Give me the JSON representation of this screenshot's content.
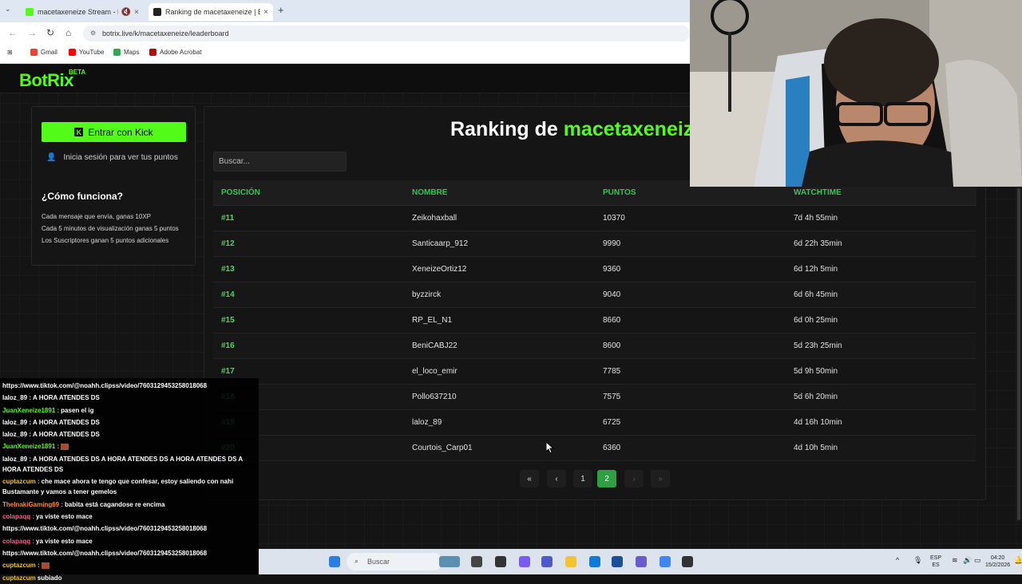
{
  "browser": {
    "tabs": [
      {
        "title": "macetaxeneize Stream - Ki"
      },
      {
        "title": "Ranking de macetaxeneize | B"
      }
    ],
    "url": "botrix.live/k/macetaxeneize/leaderboard",
    "bookmarks": [
      {
        "label": "Gmail",
        "color": "#ea4335"
      },
      {
        "label": "YouTube",
        "color": "#ff0000"
      },
      {
        "label": "Maps",
        "color": "#34a853"
      },
      {
        "label": "Adobe Acrobat",
        "color": "#b30b00"
      }
    ]
  },
  "site": {
    "logo": "BotRix",
    "beta": "BETA",
    "sidebar": {
      "kick_button": "Entrar con Kick",
      "kick_icon": "K",
      "login_text": "Inicia sesión para ver tus puntos",
      "how_title": "¿Cómo funciona?",
      "how_items": [
        "Cada mensaje que envía, ganas 10XP",
        "Cada 5 minutos de visualización ganas 5 puntos",
        "Los Suscriptores ganan 5 puntos adicionales"
      ]
    },
    "ranking": {
      "title_prefix": "Ranking de",
      "title_channel": "macetaxeneize",
      "search_placeholder": "Buscar...",
      "columns": [
        "POSICIÓN",
        "NOMBRE",
        "PUNTOS",
        "WATCHTIME"
      ],
      "rows": [
        {
          "pos": "#11",
          "name": "Zeikohaxball",
          "points": "10370",
          "watch": "7d 4h 55min"
        },
        {
          "pos": "#12",
          "name": "Santicaarp_912",
          "points": "9990",
          "watch": "6d 22h 35min"
        },
        {
          "pos": "#13",
          "name": "XeneizeOrtiz12",
          "points": "9360",
          "watch": "6d 12h 5min"
        },
        {
          "pos": "#14",
          "name": "byzzirck",
          "points": "9040",
          "watch": "6d 6h 45min"
        },
        {
          "pos": "#15",
          "name": "RP_EL_N1",
          "points": "8660",
          "watch": "6d 0h 25min"
        },
        {
          "pos": "#16",
          "name": "BeniCABJ22",
          "points": "8600",
          "watch": "5d 23h 25min"
        },
        {
          "pos": "#17",
          "name": "el_loco_emir",
          "points": "7785",
          "watch": "5d 9h 50min"
        },
        {
          "pos": "#18",
          "name": "Pollo637210",
          "points": "7575",
          "watch": "5d 6h 20min"
        },
        {
          "pos": "#19",
          "name": "laloz_89",
          "points": "6725",
          "watch": "4d 16h 10min"
        },
        {
          "pos": "#20",
          "name": "Courtois_Carp01",
          "points": "6360",
          "watch": "4d 10h 5min"
        }
      ],
      "pagination": {
        "first": "«",
        "prev": "‹",
        "pages": [
          "1",
          "2"
        ],
        "current": "2",
        "next": "›",
        "last": "»"
      }
    }
  },
  "chat": {
    "messages": [
      {
        "user": "",
        "text": "https://www.tiktok.com/@noahh.clipss/video/7603129453258018068",
        "color": "#ffffff"
      },
      {
        "user": "laloz_89 :",
        "text": "A HORA ATENDES DS",
        "color": "#ffffff"
      },
      {
        "user": "JuanXeneize1891 :",
        "text": "pasen el ig",
        "color": "#53fc18"
      },
      {
        "user": "laloz_89 :",
        "text": "A HORA ATENDES DS",
        "color": "#ffffff"
      },
      {
        "user": "laloz_89 :",
        "text": "A HORA ATENDES DS",
        "color": "#ffffff"
      },
      {
        "user": "JuanXeneize1891 :",
        "text": "",
        "color": "#53fc18"
      },
      {
        "user": "laloz_89 :",
        "text": "A HORA ATENDES DS A HORA ATENDES DS A HORA ATENDES DS A HORA ATENDES DS",
        "color": "#ffffff"
      },
      {
        "user": "cuptazcum :",
        "text": "che mace ahora te tengo que confesar, estoy saliendo con nahi Bustamante y vamos a tener gemelos",
        "color": "#f5c518"
      },
      {
        "user": "TheInakiGaming69 :",
        "text": "babita está cagandose re encima",
        "color": "#ff8c2a"
      },
      {
        "user": "colapaqq :",
        "text": "ya viste esto mace",
        "color": "#ff5d8f"
      },
      {
        "user": "",
        "text": "https://www.tiktok.com/@noahh.clipss/video/7603129453258018068",
        "color": "#ffffff"
      },
      {
        "user": "colapaqq :",
        "text": "ya viste esto mace",
        "color": "#ff5d8f"
      },
      {
        "user": "",
        "text": "https://www.tiktok.com/@noahh.clipss/video/7603129453258018068",
        "color": "#ffffff"
      },
      {
        "user": "cuptazcum :",
        "text": "",
        "color": "#f5c518"
      },
      {
        "user": "cuptazcum",
        "text": "subiado",
        "color": "#f5c518"
      }
    ]
  },
  "taskbar": {
    "search_placeholder": "Buscar",
    "lang_top": "ESP",
    "lang_bottom": "ES",
    "time": "04:20",
    "date": "15/2/2026"
  }
}
